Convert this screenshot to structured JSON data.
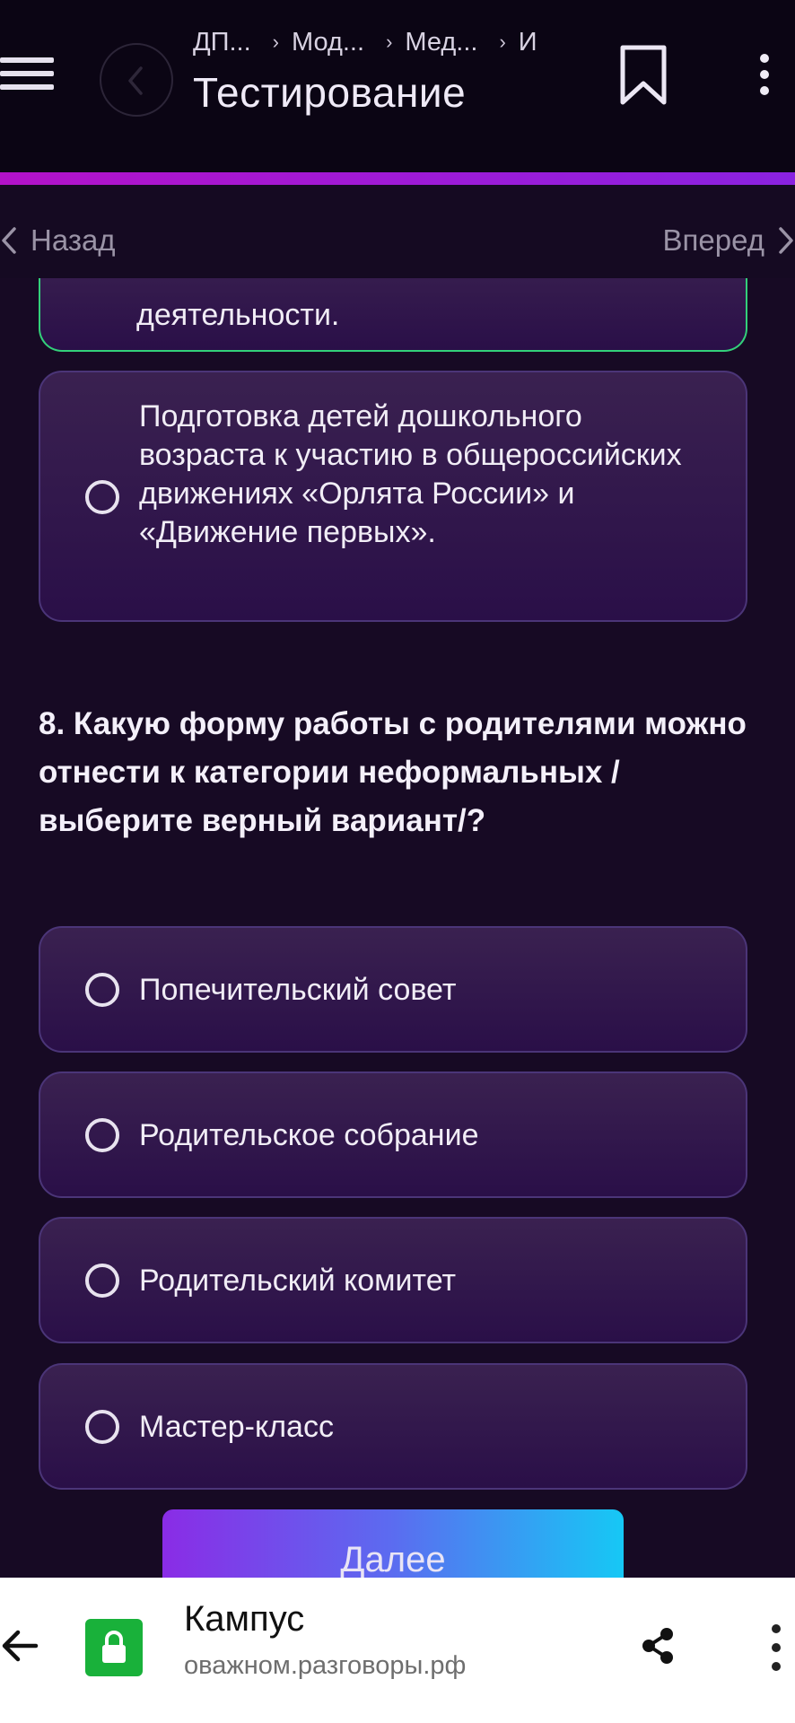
{
  "header": {
    "breadcrumbs": [
      "ДП...",
      "Мод...",
      "Мед...",
      "И"
    ],
    "title": "Тестирование"
  },
  "nav": {
    "back_label": "Назад",
    "next_label": "Вперед"
  },
  "prev_question": {
    "partial_option_text": "деятельности.",
    "option_text": "Подготовка детей дошкольного возраста к участию в общероссийских движениях «Орлята России» и «Движение первых»."
  },
  "question": {
    "text": "8.  Какую форму работы с родителями можно отнести к категории неформальных /выберите верный вариант/?",
    "options": [
      "Попечительский совет",
      "Родительское собрание",
      "Родительский комитет",
      "Мастер-класс"
    ]
  },
  "actions": {
    "next_button_label": "Далее"
  },
  "browser": {
    "site_title": "Кампус",
    "url": "оважном.разговоры.рф"
  },
  "colors": {
    "accent_bar": "#b312c9",
    "correct_border": "#33d07a",
    "button_gradient_start": "#8a2ce6",
    "button_gradient_end": "#16c8f5",
    "lock_badge": "#19b13a"
  }
}
